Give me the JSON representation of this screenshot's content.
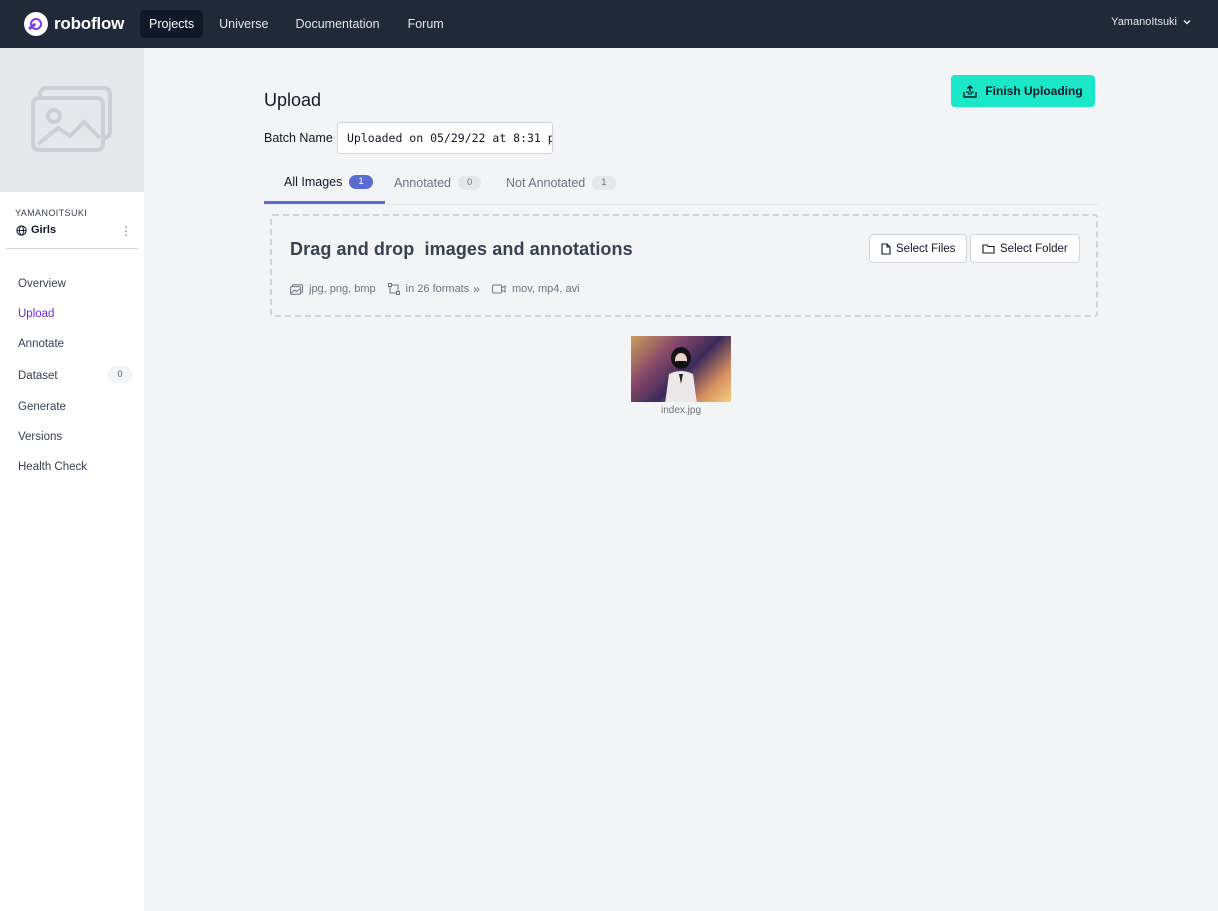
{
  "nav": {
    "brand": "roboflow",
    "items": [
      "Projects",
      "Universe",
      "Documentation",
      "Forum"
    ],
    "user": "YamanoItsuki"
  },
  "sidebar": {
    "owner": "YAMANOITSUKI",
    "project": "Girls",
    "menu": [
      {
        "label": "Overview"
      },
      {
        "label": "Upload"
      },
      {
        "label": "Annotate"
      },
      {
        "label": "Dataset",
        "count": "0"
      },
      {
        "label": "Generate"
      },
      {
        "label": "Versions"
      },
      {
        "label": "Health Check"
      }
    ]
  },
  "main": {
    "title": "Upload",
    "finish_label": "Finish Uploading",
    "batch_label": "Batch Name",
    "batch_value": "Uploaded on 05/29/22 at 8:31 p",
    "tabs": [
      {
        "label": "All Images",
        "count": "1"
      },
      {
        "label": "Annotated",
        "count": "0"
      },
      {
        "label": "Not Annotated",
        "count": "1"
      }
    ],
    "dropzone": {
      "title": "Drag and drop  images and annotations",
      "select_files": "Select Files",
      "select_folder": "Select Folder",
      "image_formats": "jpg, png, bmp",
      "annotation_formats": "in 26 formats",
      "video_formats": "mov, mp4, avi"
    },
    "files": [
      {
        "name": "index.jpg"
      }
    ]
  },
  "colors": {
    "nav_bg": "#1f2937",
    "accent_button": "#1ae8c8",
    "tab_active": "#5b6bd4",
    "menu_active": "#6d28d9"
  }
}
